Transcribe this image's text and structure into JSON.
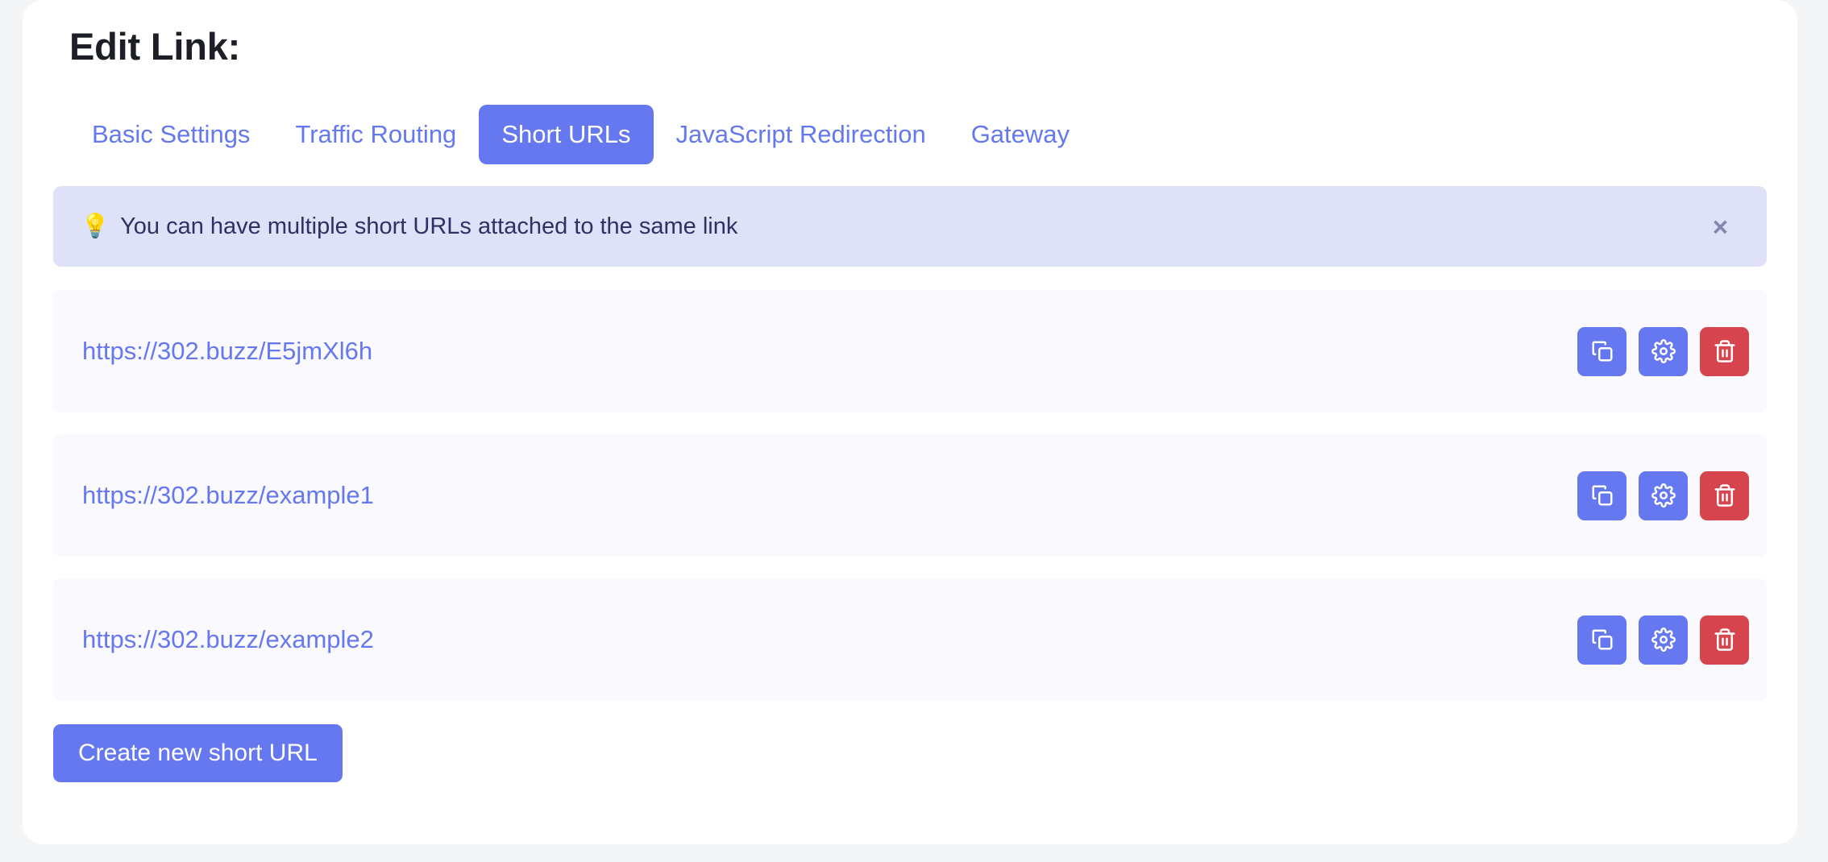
{
  "page": {
    "title": "Edit Link:"
  },
  "tabs": [
    {
      "label": "Basic Settings",
      "active": false
    },
    {
      "label": "Traffic Routing",
      "active": false
    },
    {
      "label": "Short URLs",
      "active": true
    },
    {
      "label": "JavaScript Redirection",
      "active": false
    },
    {
      "label": "Gateway",
      "active": false
    }
  ],
  "banner": {
    "emoji": "💡",
    "message": "You can have multiple short URLs attached to the same link",
    "close_label": "×"
  },
  "short_urls": [
    {
      "url": "https://302.buzz/E5jmXl6h"
    },
    {
      "url": "https://302.buzz/example1"
    },
    {
      "url": "https://302.buzz/example2"
    }
  ],
  "row_actions": {
    "copy_icon": "copy-icon",
    "settings_icon": "gear-icon",
    "delete_icon": "trash-icon"
  },
  "footer": {
    "create_label": "Create new short URL"
  },
  "colors": {
    "accent": "#6678ef",
    "accent_text": "#6478ef",
    "danger": "#d6454e",
    "banner_bg": "#dfe1f8",
    "banner_text": "#2d3163",
    "row_bg": "#f9f9fe",
    "card_bg": "#ffffff",
    "page_bg": "#f4f5f7",
    "title_text": "#1c1f26"
  }
}
